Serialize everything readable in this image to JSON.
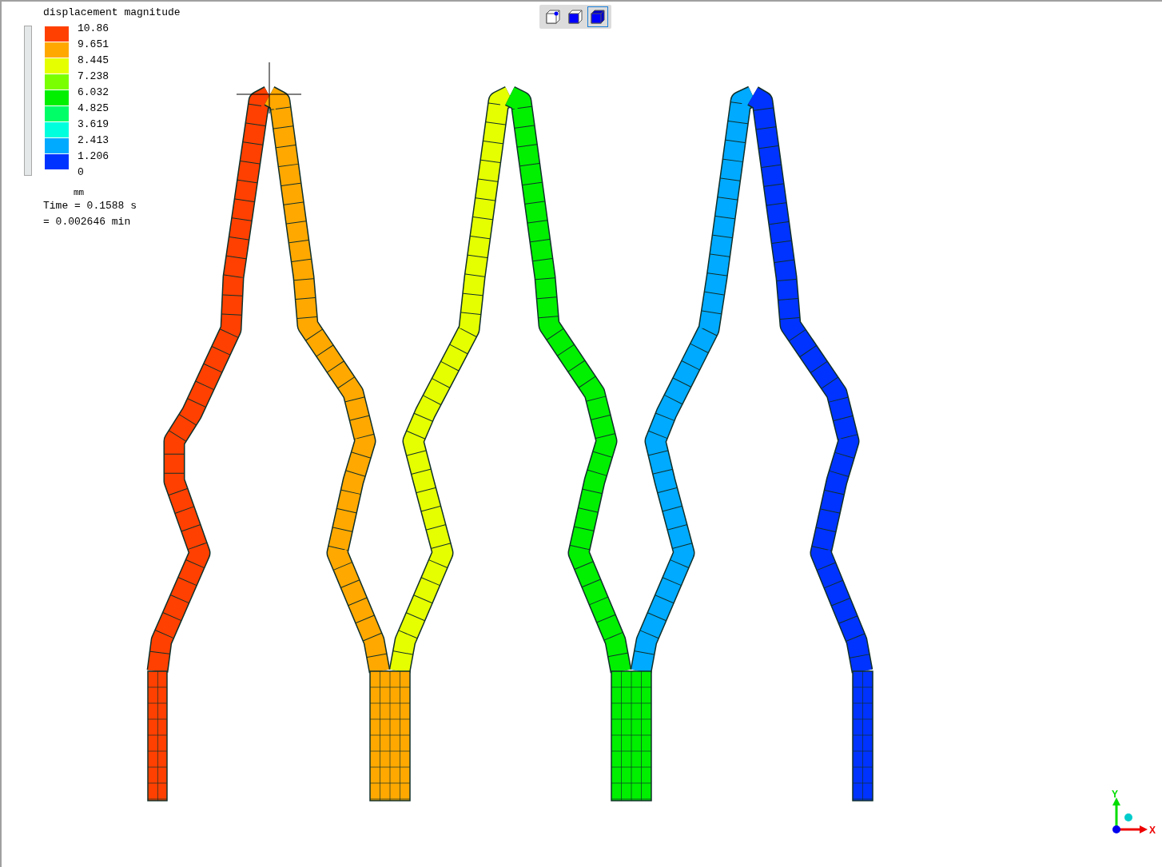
{
  "legend": {
    "title": "displacement magnitude",
    "levels": [
      {
        "label": "10.86",
        "color": "#ff4000"
      },
      {
        "label": "9.651",
        "color": "#ffa800"
      },
      {
        "label": "8.445",
        "color": "#e6ff00"
      },
      {
        "label": "7.238",
        "color": "#7aff00"
      },
      {
        "label": "6.032",
        "color": "#00f000"
      },
      {
        "label": "4.825",
        "color": "#00ff66"
      },
      {
        "label": "3.619",
        "color": "#00ffdd"
      },
      {
        "label": "2.413",
        "color": "#00aaff"
      },
      {
        "label": "1.206",
        "color": "#0033ff"
      },
      {
        "label": "0"
      }
    ],
    "unit": "mm",
    "time_lines": [
      "Time = 0.1588 s",
      "= 0.002646 min"
    ]
  },
  "toolbar": [
    {
      "kind": "wireframe",
      "selected": false
    },
    {
      "kind": "solid",
      "selected": false
    },
    {
      "kind": "solid-shaded",
      "selected": true
    }
  ],
  "axes": {
    "y_label": "Y",
    "x_label": "X"
  }
}
